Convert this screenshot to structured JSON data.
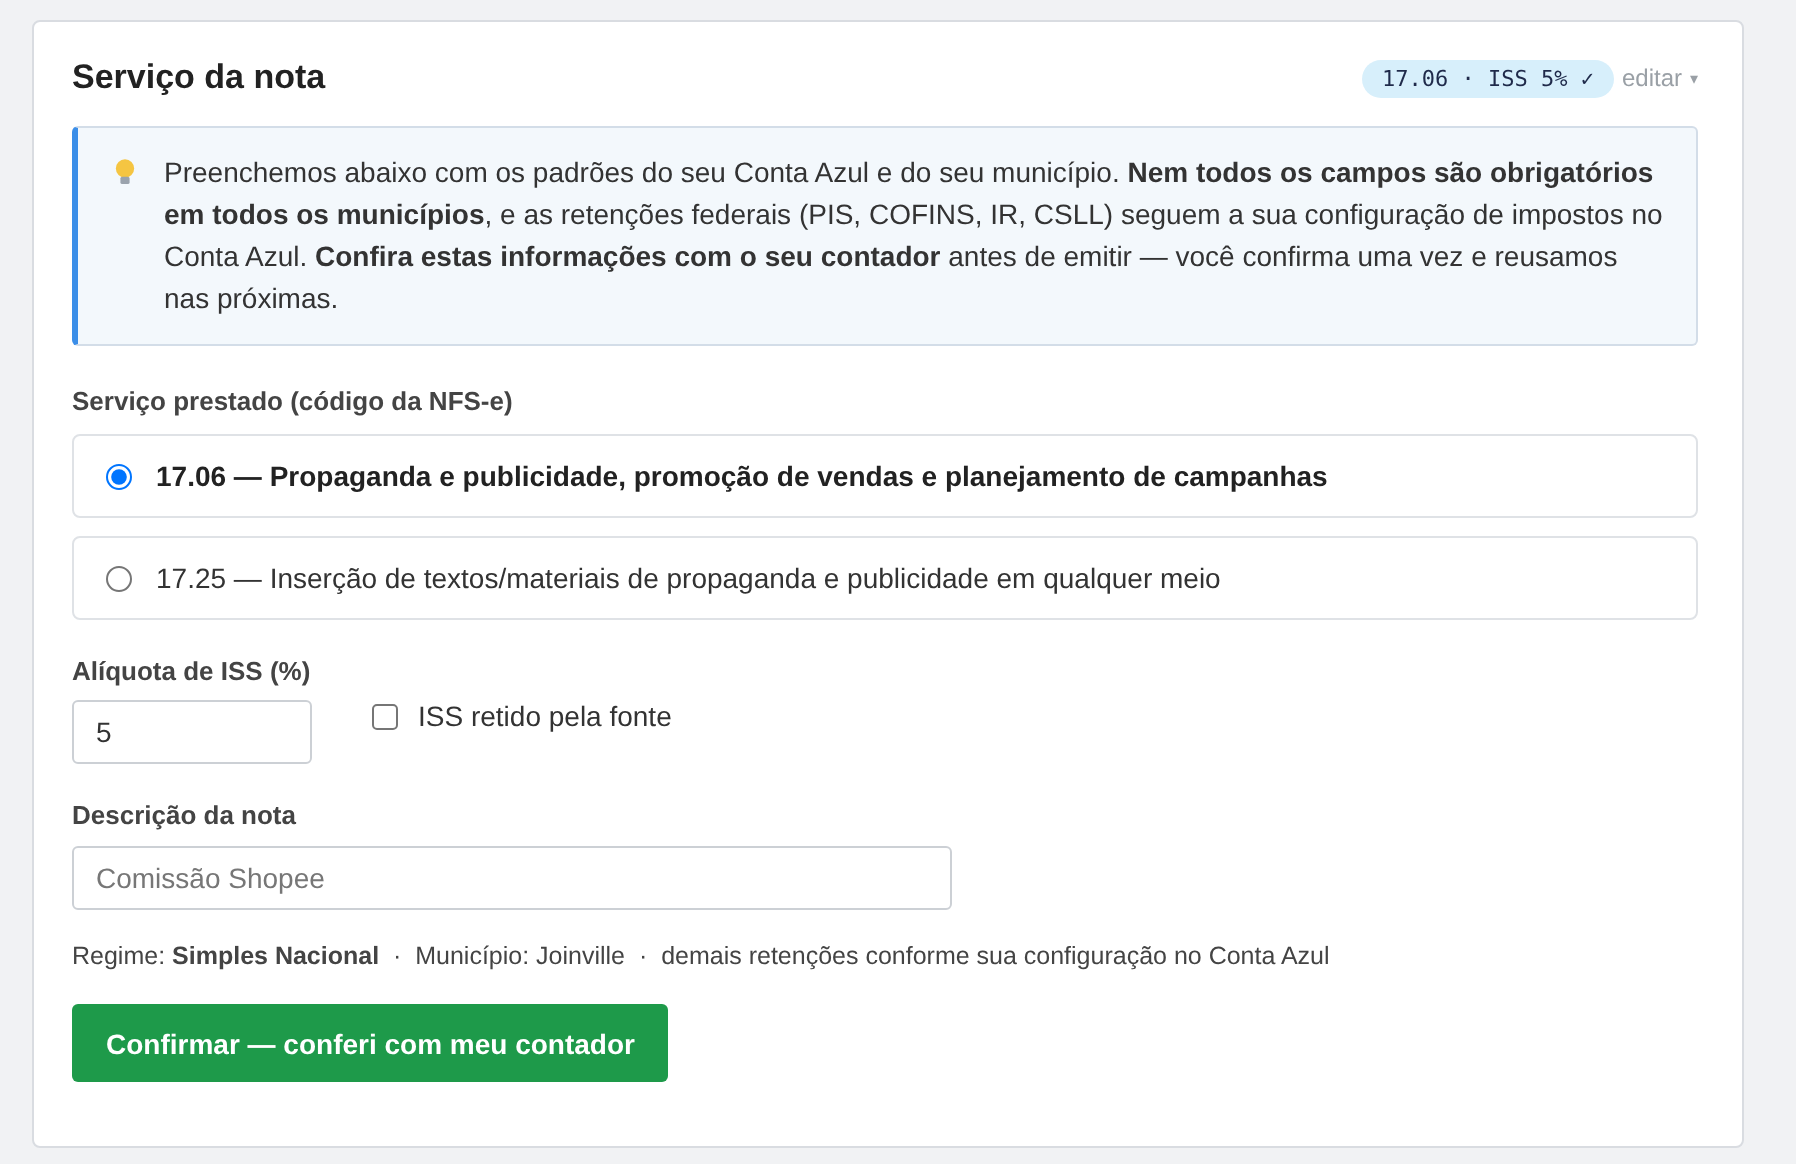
{
  "card": {
    "title": "Serviço da nota",
    "badge": "17.06 · ISS 5% ✓",
    "edit_link": "editar",
    "edit_caret": "▾"
  },
  "info": {
    "text": "Preenchemos abaixo com os padrões do seu Conta Azul e do seu município. **Nem todos os campos são obrigatórios em todos os municípios**, e as retenções federais (PIS, COFINS, IR, CSLL) seguem a sua configuração de impostos no Conta Azul. **Confira estas informações com o seu contador** antes de emitir — você confirma uma vez e reusamos nas próximas."
  },
  "service": {
    "label": "Serviço prestado (código da NFS-e)",
    "options": [
      {
        "label": "17.06 — Propaganda e publicidade, promoção de vendas e planejamento de campanhas",
        "selected": true
      },
      {
        "label": "17.25 — Inserção de textos/materiais de propaganda e publicidade em qualquer meio",
        "selected": false
      }
    ]
  },
  "iss": {
    "label": "Alíquota de ISS (%)",
    "value": "5",
    "withheld": {
      "label": "ISS retido pela fonte",
      "checked": false
    }
  },
  "description": {
    "label": "Descrição da nota",
    "placeholder": "Comissão Shopee"
  },
  "summary": "Regime: **Simples Nacional**  ·  Município: Joinville  ·  demais retenções conforme sua configuração no Conta Azul",
  "confirm_button": "Confirmar — conferi com meu contador"
}
